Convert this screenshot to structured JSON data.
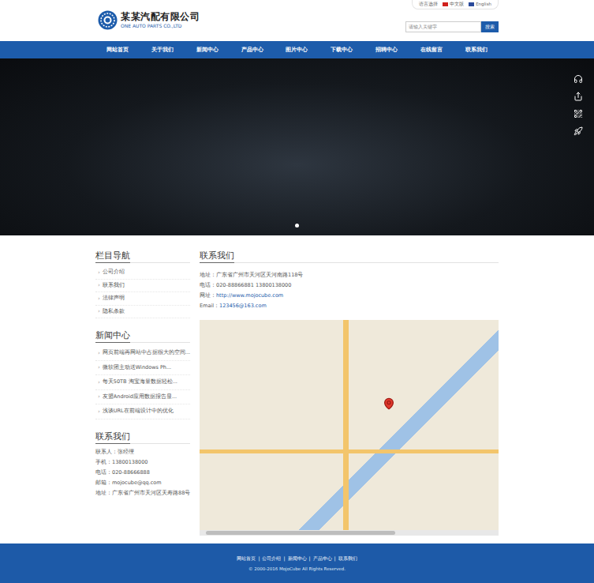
{
  "header": {
    "company_name": "某某汽配有限公司",
    "company_name_en": "ONE AUTO PARTS CO.,LTD",
    "language_label": "语言选择",
    "languages": [
      {
        "label": "中文版",
        "color": "#d0201c"
      },
      {
        "label": "English",
        "color": "#2a4a9a"
      }
    ],
    "search": {
      "placeholder": "请输入关键字",
      "button": "搜索"
    }
  },
  "nav": [
    {
      "label": "网站首页"
    },
    {
      "label": "关于我们"
    },
    {
      "label": "新闻中心"
    },
    {
      "label": "产品中心"
    },
    {
      "label": "图片中心"
    },
    {
      "label": "下载中心"
    },
    {
      "label": "招聘中心"
    },
    {
      "label": "在线留言"
    },
    {
      "label": "联系我们"
    }
  ],
  "banner": {
    "slides": [
      {
        "selected": true
      }
    ]
  },
  "column_nav": {
    "title": "栏目导航",
    "bullet": "›",
    "items": [
      {
        "label": "公司介绍"
      },
      {
        "label": "联系我们"
      },
      {
        "label": "法律声明"
      },
      {
        "label": "隐私条款"
      }
    ]
  },
  "news": {
    "title": "新闻中心",
    "bullet": "›",
    "items": [
      {
        "label": "网页前端再网站中占据很大的空间..."
      },
      {
        "label": "微软团主动送Windows Ph..."
      },
      {
        "label": "每天50TB 淘宝海量数据轻松..."
      },
      {
        "label": "友盟Android应用数据报告显..."
      },
      {
        "label": "浅谈URL在前端设计中的优化"
      }
    ]
  },
  "contact": {
    "title": "联系我们",
    "lines": [
      "联系人：张经理",
      "手机：13800138000",
      "电话：020-88666888",
      "邮箱：mojocube@qq.com",
      "地址：广东省广州市天河区天寿路88号"
    ]
  },
  "main": {
    "title": "联系我们",
    "lines": [
      {
        "label": "地址：",
        "value": "广东省广州市天河区天河南路118号",
        "kind": "text"
      },
      {
        "label": "电话：",
        "value": "020-88866881 13800138000",
        "kind": "text"
      },
      {
        "label": "网址：",
        "value": "http://www.mojocube.com",
        "kind": "link"
      },
      {
        "label": "Email：",
        "value": "123456@163.com",
        "kind": "link"
      }
    ]
  },
  "footer": {
    "separator": "|",
    "links": [
      "网站首页",
      "公司介绍",
      "新闻中心",
      "产品中心",
      "联系我们"
    ],
    "copyright": "© 2000-2016 MojoCube All Rights Reserved."
  }
}
